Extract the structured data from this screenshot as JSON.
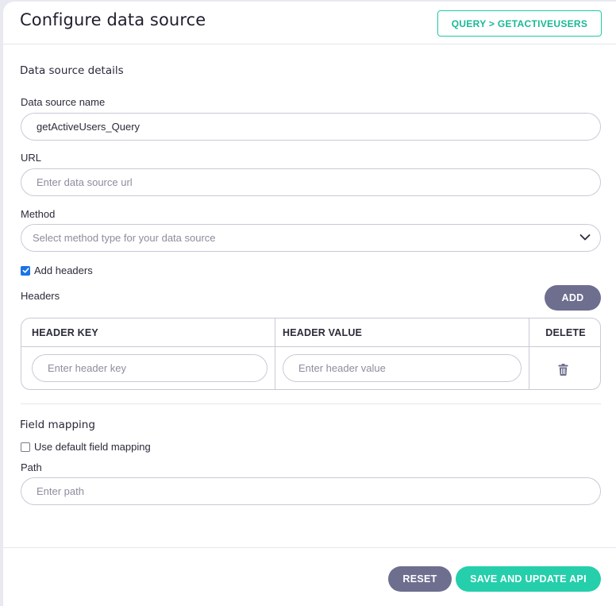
{
  "header": {
    "title": "Configure data source",
    "query_button": "QUERY > GETACTIVEUSERS"
  },
  "details": {
    "section_title": "Data source details",
    "name_label": "Data source name",
    "name_value": "getActiveUsers_Query",
    "url_label": "URL",
    "url_placeholder": "Enter data source url",
    "method_label": "Method",
    "method_placeholder": "Select method type for your data source",
    "add_headers_label": "Add headers",
    "add_headers_checked": true
  },
  "headers": {
    "label": "Headers",
    "add_button": "ADD",
    "columns": [
      "HEADER KEY",
      "HEADER VALUE",
      "DELETE"
    ],
    "key_placeholder": "Enter header key",
    "value_placeholder": "Enter header value",
    "delete_icon": "trash-icon"
  },
  "field_mapping": {
    "section_title": "Field mapping",
    "default_label": "Use default field mapping",
    "default_checked": false,
    "path_label": "Path",
    "path_placeholder": "Enter path"
  },
  "footer": {
    "reset_button": "RESET",
    "save_button": "SAVE AND UPDATE API"
  },
  "colors": {
    "accent_green": "#25cfab",
    "button_gray": "#6e6e8f",
    "checkbox_blue": "#1a73e8"
  }
}
